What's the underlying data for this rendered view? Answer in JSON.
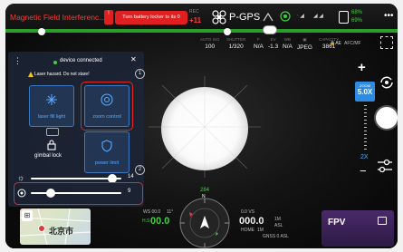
{
  "topbar": {
    "alert_title": "Magnetic Field Interferenc...",
    "warn_badge": "!",
    "warn_button": "Turn battery locker to its 0",
    "rec_label": "REC",
    "rec_value": "+11",
    "gps_label": "P-GPS",
    "signal_label_1": "ᐧ ◢",
    "signal_label_2": "◢ ◢",
    "battery_pct_top": "68%",
    "battery_pct_bottom": "69%",
    "more_label": "•••"
  },
  "camera": {
    "params": [
      {
        "key": "AUTO ISO",
        "value": "100"
      },
      {
        "key": "SHUTTER",
        "value": "1/320"
      },
      {
        "key": "F",
        "value": "N/A"
      },
      {
        "key": "EV",
        "value": "-1.3"
      },
      {
        "key": "WB",
        "value": "N/A"
      },
      {
        "key": "▣",
        "value": "JPEG"
      },
      {
        "key": "CAPACITY",
        "value": "3861"
      }
    ],
    "ae_label": "🔒AE",
    "ae_off_label": "AFC/MF"
  },
  "panel": {
    "connection_text": "device connected",
    "hazard_text": "Laser hazard. Do not stare!",
    "tiles": {
      "laser_fill_light": "laser fill light",
      "zoom_control": "zoom control",
      "gimbal_lock": "gimbal lock",
      "power_limit": "power limit",
      "ghost_label": "... "
    },
    "badge_1": "1",
    "badge_2": "2",
    "brightness_value": "14",
    "brightness_level": 0.9,
    "zoom_slider_value": "9",
    "zoom_slider_level": 0.22
  },
  "right": {
    "zoom_badge_label": "ZOOM",
    "zoom_value": "5.0X",
    "zoom_tick": "2X",
    "plus": "+",
    "minus": "−"
  },
  "bottom": {
    "map_city": "北京市",
    "tel_ws_label": "WS 00.0",
    "tel_ws_sub": "11°",
    "tel_hs_value": "00.0",
    "tel_hs_prefix": "H.S",
    "tel_alt_label": "0.0 VS",
    "tel_alt_value": "000.0",
    "tel_alt_sub": "1M",
    "tel_alt_unit": "ASL",
    "tel_rth_label": "HOME",
    "tel_rth_value": "1M",
    "tel_gnss": "GNSS 0 ASL",
    "compass_heading": "284",
    "compass_n": "N",
    "fpv_label": "FPV"
  }
}
